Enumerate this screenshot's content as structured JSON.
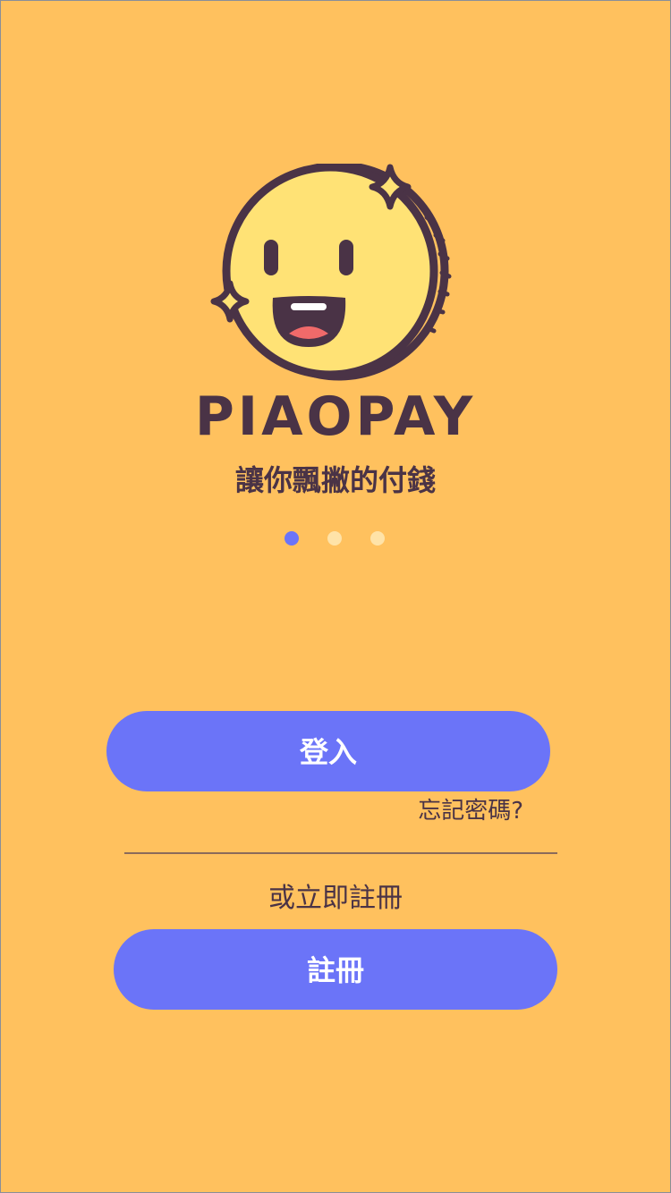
{
  "app": {
    "brand_name": "PIAOPAY",
    "tagline": "讓你飄撇的付錢"
  },
  "carousel": {
    "total_pages": 3,
    "active_page": 1
  },
  "auth": {
    "login_label": "登入",
    "forgot_password_label": "忘記密碼?",
    "or_register_label": "或立即註冊",
    "register_label": "註冊"
  },
  "icons": {
    "logo": "smiling-coin-icon",
    "sparkle": "sparkle-icon"
  },
  "colors": {
    "background": "#FFC15E",
    "primary": "#6B74F8",
    "text_dark": "#4A3346",
    "dot_inactive": "#FFE3A8",
    "coin_face": "#FFE275",
    "mouth": "#4A3346",
    "tongue": "#F06A6A",
    "teeth": "#FFFFFF",
    "divider": "#8A6A5A"
  }
}
